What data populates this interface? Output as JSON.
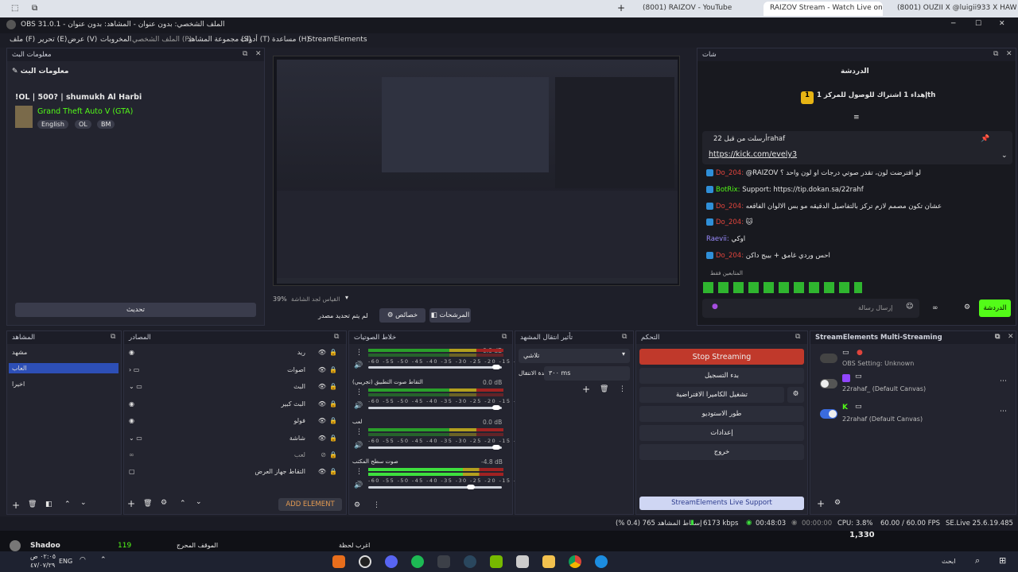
{
  "browser": {
    "tabs": [
      "(8001) RAIZOV - YouTube",
      "RAIZOV Stream - Watch Live on Kick",
      "(8001) OUZII X @luigii933 X HAW"
    ],
    "new_tab": "+"
  },
  "window": {
    "title": "OBS 31.0.1 - الملف الشخصي: بدون عنوان - المشاهد: بدون عنوان",
    "min": "─",
    "max": "☐",
    "close": "✕"
  },
  "menu": [
    "ملف (F)",
    "تحرير (E)",
    "عرض (V)",
    "المخروبات",
    "الملف الشخصي (P)",
    "مجموعة المشاهد (S)",
    "أدوات (T)",
    "مساعدة (H)",
    "StreamElements"
  ],
  "stream_info": {
    "header": "معلومات البث",
    "title": "!OL | 500? | shumukh Al Harbi",
    "label": "معلومات البث",
    "game": "Grand Theft Auto V (GTA)",
    "tags": [
      "English",
      "OL",
      "BM"
    ],
    "update_btn": "تحديث"
  },
  "preview": {
    "zoom": "39%",
    "scale_label": "القياس لجد الشاشة",
    "no_source": "لم يتم تحديد مصدر",
    "props_btn": "خصائص",
    "filters_btn": "المرشحات"
  },
  "chat": {
    "header": "شات",
    "tab": "الدردشة",
    "sub_goal": "إهداء 1 اشتراك للوصول للمركز 1th",
    "pinned_by": "أرسلت من قبل 22rahaf",
    "pinned_link": "https://kick.com/evely3",
    "lines": [
      {
        "user": "Do_204:",
        "msg": "@RAIZOV لو افترضت لون، تقدر صوتي درجات او لون واحد ؟"
      },
      {
        "user": "BotRix:",
        "msg": "Support: https://tip.dokan.sa/22rahf"
      },
      {
        "user": "Do_204:",
        "msg": "عشان تكون مصمم لازم تركز بالتفاصيل الدقيقه مو بس الالوان الفاقعه"
      },
      {
        "user": "Do_204:",
        "msg": "🐱"
      },
      {
        "user": "Raevii:",
        "msg": "اوكي"
      },
      {
        "user": "Do_204:",
        "msg": "احس وردي غامق + بيبج داكن"
      }
    ],
    "emotes_label": "المتابعين فقط",
    "input_placeholder": "إرسال رسالة",
    "send_btn": "الدردشة"
  },
  "scenes": {
    "header": "المشاهد",
    "items": [
      "مشهد",
      "العاب",
      "اخيرا"
    ],
    "selected": 1
  },
  "sources": {
    "header": "المصادر",
    "items": [
      "ريد",
      "اصوات",
      "البث",
      "البث كبير",
      "فولو",
      "شاشة",
      "لعب",
      "التقاط جهاز العرض"
    ],
    "add_element": "ADD ELEMENT"
  },
  "mixer": {
    "header": "خلاط الصوتيات",
    "channels": [
      {
        "name": "",
        "db": "0.0 dB"
      },
      {
        "name": "التقاط صوت التطبيق (تجريبي)",
        "db": "0.0 dB"
      },
      {
        "name": "لعب",
        "db": "0.0 dB"
      },
      {
        "name": "صوت سطح المكتب",
        "db": "-4.8 dB"
      }
    ],
    "scale": "-60 -55 -50 -45 -40 -35 -30 -25 -20 -15 -10 -5 0"
  },
  "transitions": {
    "header": "تأثير انتقال المشهد",
    "selected": "تلاشي",
    "duration_label": "مدة الانتقال",
    "duration": "٣٠٠ ms"
  },
  "controls": {
    "header": "التحكم",
    "stop_streaming": "Stop Streaming",
    "start_recording": "بدء التسجيل",
    "virtual_cam": "تشغيل الكاميرا الافتراضية",
    "studio_mode": "طور الاستوديو",
    "settings": "إعدادات",
    "exit": "خروج",
    "se_support": "StreamElements Live Support"
  },
  "multistream": {
    "header": "StreamElements Multi-Streaming",
    "rows": [
      {
        "label": "OBS Setting: Unknown",
        "on": false
      },
      {
        "label": "22rahaf_ (Default Canvas)",
        "on": false
      },
      {
        "label": "22rahaf (Default Canvas)",
        "on": true
      }
    ]
  },
  "status": {
    "dropped": "إسقاط المشاهد 765 (0.4 %)",
    "kbps": "6173 kbps",
    "live_time": "00:48:03",
    "rec_time": "00:00:00",
    "cpu": "CPU: 3.8%",
    "fps": "60.00 / 60.00 FPS",
    "version": "SE.Live 25.6.19.485"
  },
  "below": {
    "user": "Shadoo",
    "count": "119",
    "item1": "الموقف المحرج",
    "item2": "اغرب لحظة",
    "viewers": "1,330"
  },
  "taskbar": {
    "time": "٠٢:٠٥ ص",
    "date": "٤٧/٠٧/٢٩",
    "lang": "ENG",
    "search": "ابحث"
  },
  "colors": {
    "accent": "#53fc18",
    "stop": "#c0392b",
    "selection": "#2d4fb6"
  }
}
